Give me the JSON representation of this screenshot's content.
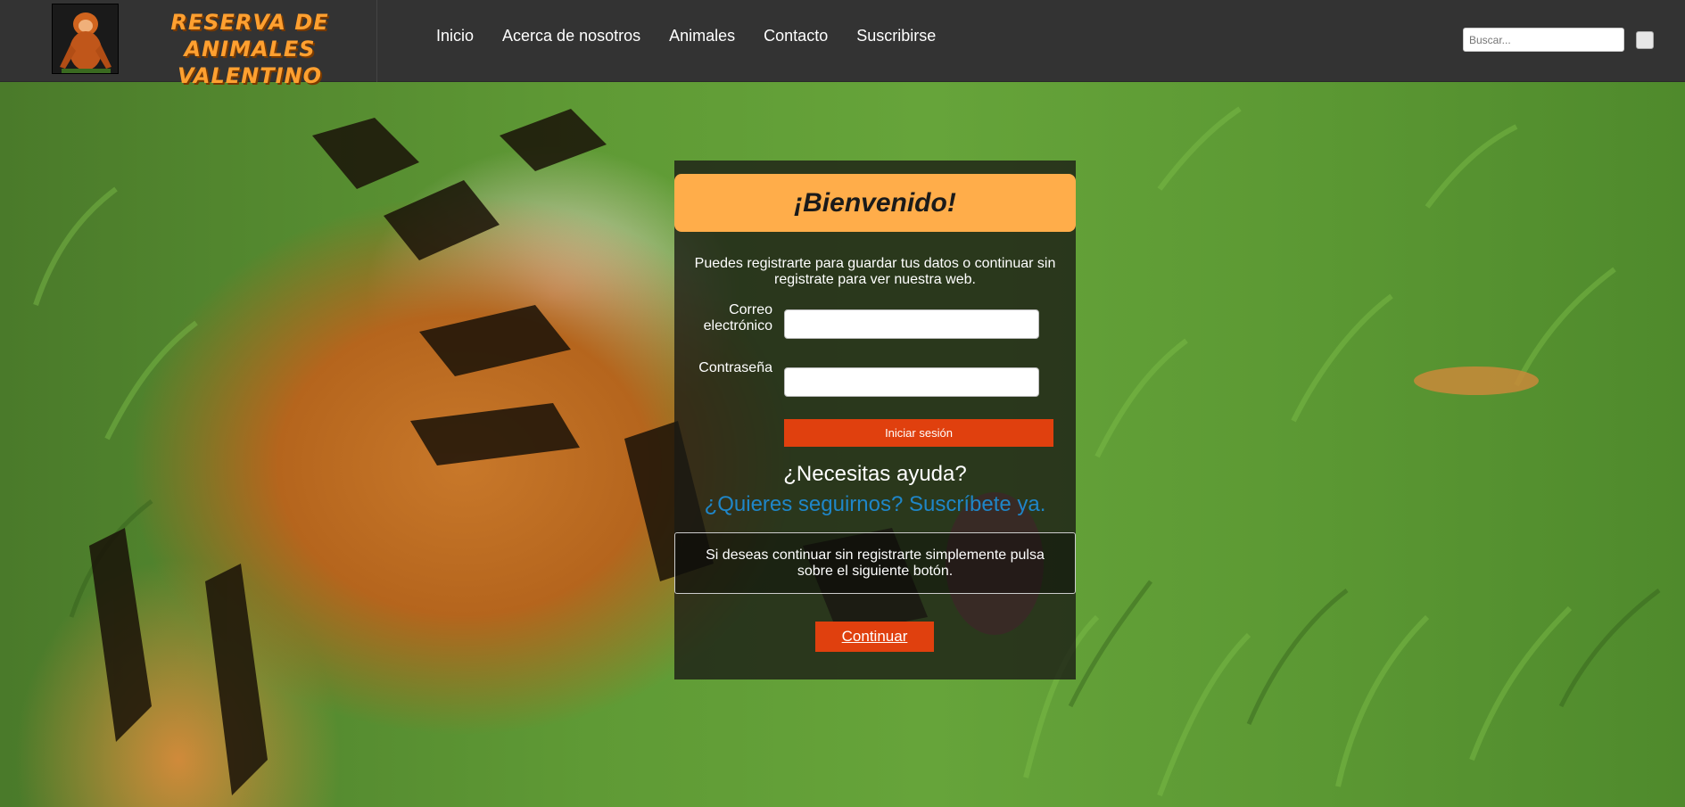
{
  "header": {
    "brand_line1": "RESERVA DE ANIMALES",
    "brand_line2": "VALENTINO",
    "logo_icon": "orangutan-logo",
    "nav": [
      {
        "label": "Inicio"
      },
      {
        "label": "Acerca de nosotros"
      },
      {
        "label": "Animales"
      },
      {
        "label": "Contacto"
      },
      {
        "label": "Suscribirse"
      }
    ],
    "search": {
      "placeholder": "Buscar..."
    }
  },
  "login": {
    "title": "¡Bienvenido!",
    "intro": "Puedes registrarte para guardar tus datos o continuar sin registrate para ver nuestra web.",
    "email_label_1": "Correo",
    "email_label_2": "electrónico",
    "password_label": "Contraseña",
    "submit_label": "Iniciar sesión",
    "help": "¿Necesitas ayuda?",
    "follow_link": "¿Quieres seguirnos? Suscríbete ya.",
    "notice": "Si deseas continuar sin registrarte simplemente pulsa sobre el siguiente botón.",
    "continue_label": "Continuar"
  },
  "colors": {
    "header_bg": "#333333",
    "brand": "#ffa030",
    "welcome_bg": "#ffad4a",
    "action": "#e0400e",
    "link": "#1f86c8"
  }
}
